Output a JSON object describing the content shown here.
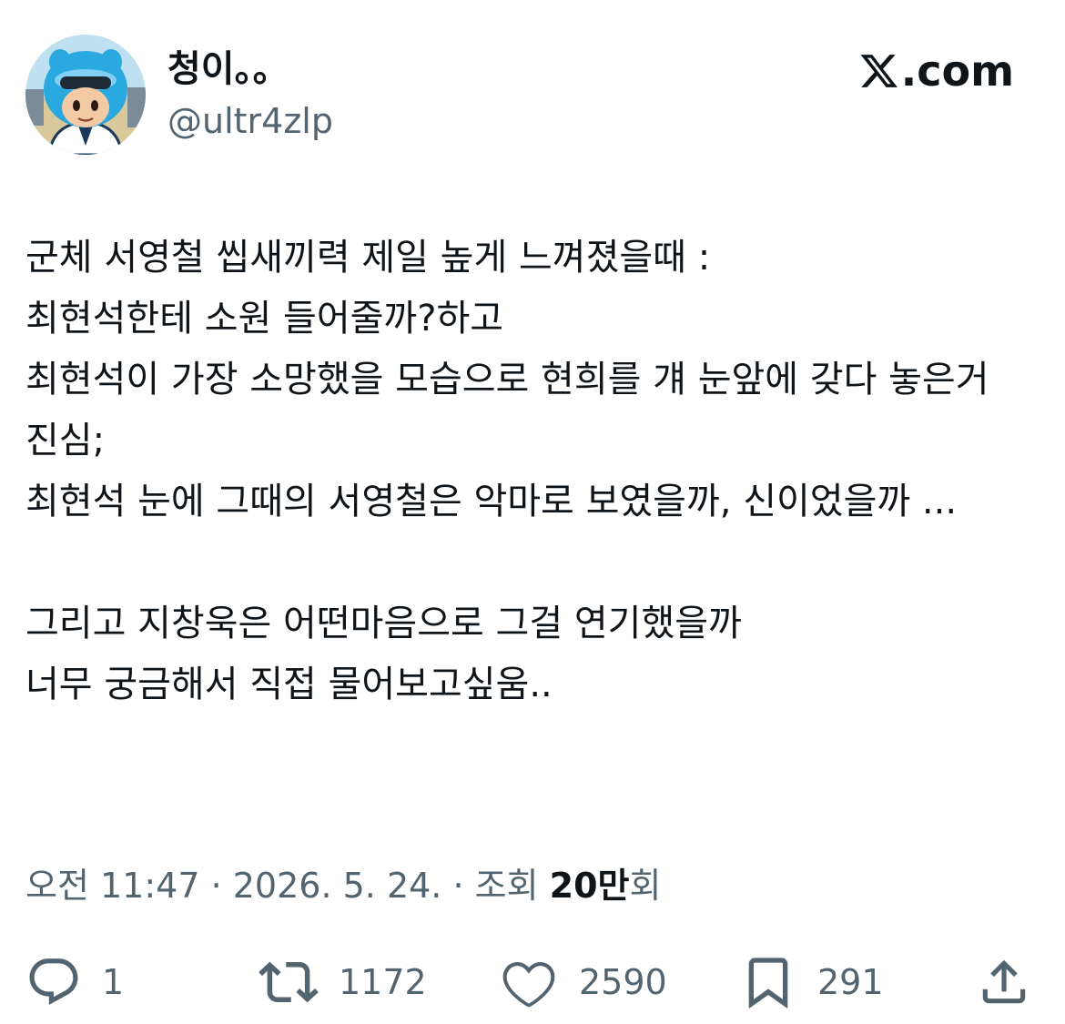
{
  "author": {
    "display_name": "청이。。",
    "handle": "@ultr4zlp"
  },
  "brand": {
    "label": ".com",
    "icon": "x-logo-icon"
  },
  "tweet": {
    "text": "군체 서영철 씹새끼력 제일 높게 느껴졌을때 :\n최현석한테 소원 들어줄까?하고\n최현석이 가장 소망했을 모습으로 현희를 걔 눈앞에 갖다 놓은거 진심;\n최현석 눈에 그때의 서영철은 악마로 보였을까, 신이었을까 ...\n\n그리고 지창욱은 어떤마음으로 그걸 연기했을까\n너무 궁금해서 직접 물어보고싶움.."
  },
  "meta": {
    "timestamp": "오전 11:47 · 2026. 5. 24. · 조회 ",
    "views_count": "20만",
    "views_suffix": "회"
  },
  "actions": {
    "reply": {
      "icon": "reply-icon",
      "count": "1"
    },
    "retweet": {
      "icon": "retweet-icon",
      "count": "1172"
    },
    "like": {
      "icon": "heart-icon",
      "count": "2590"
    },
    "bookmark": {
      "icon": "bookmark-icon",
      "count": "291"
    },
    "share": {
      "icon": "share-icon"
    }
  },
  "colors": {
    "text_primary": "#0f1419",
    "text_secondary": "#536471",
    "background": "#ffffff",
    "avatar_accent": "#2aa8e0"
  }
}
